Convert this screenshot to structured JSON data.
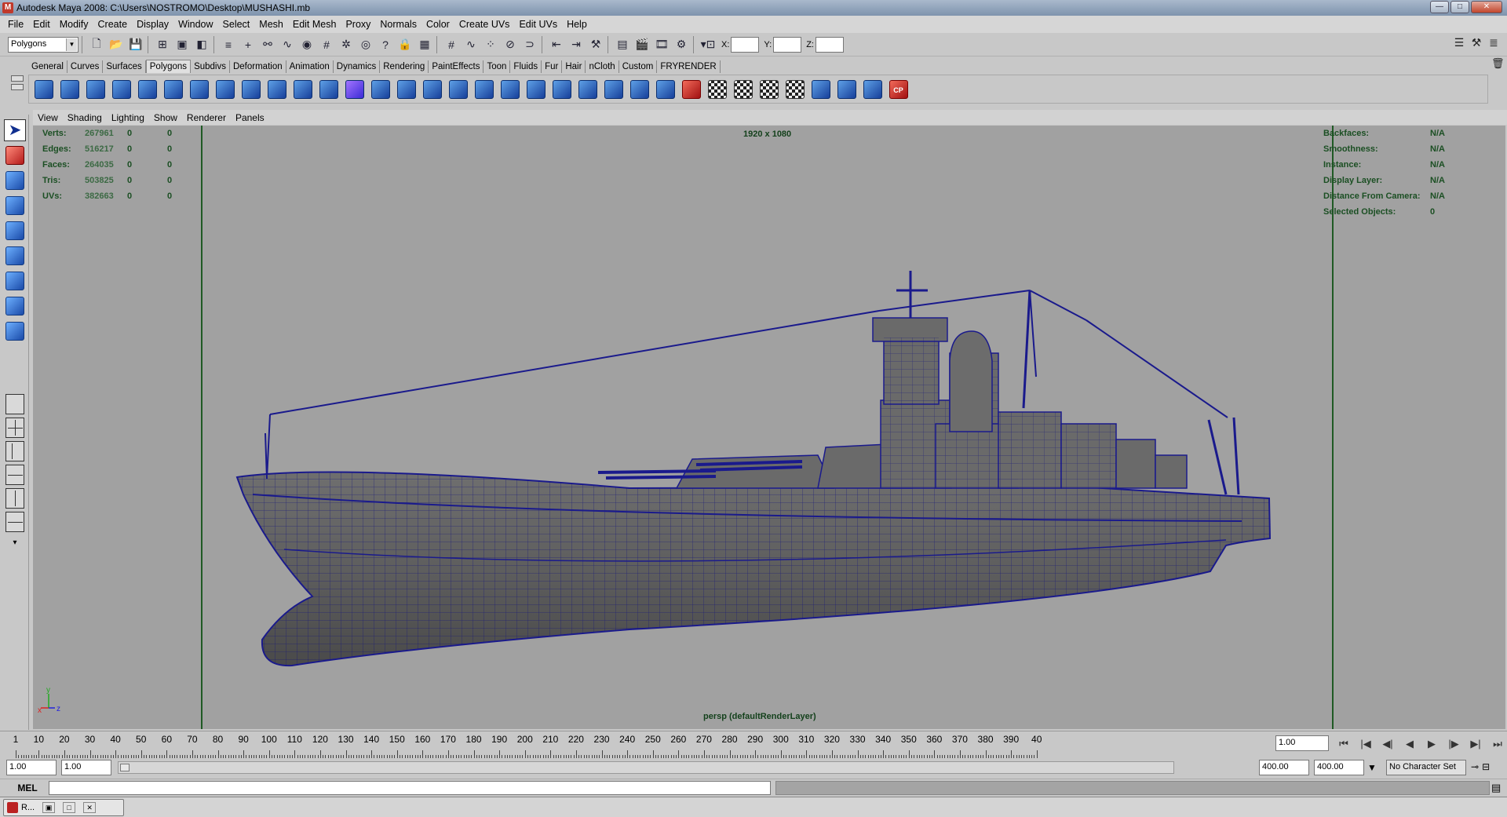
{
  "window": {
    "title": "Autodesk Maya 2008: C:\\Users\\NOSTROMO\\Desktop\\MUSHASHI.mb",
    "minimize": "—",
    "maximize": "□",
    "close": "✕"
  },
  "menubar": [
    "File",
    "Edit",
    "Modify",
    "Create",
    "Display",
    "Window",
    "Select",
    "Mesh",
    "Edit Mesh",
    "Proxy",
    "Normals",
    "Color",
    "Create UVs",
    "Edit UVs",
    "Help"
  ],
  "statusline": {
    "mode": "Polygons",
    "x_label": "X:",
    "y_label": "Y:",
    "z_label": "Z:",
    "x_value": "",
    "y_value": "",
    "z_value": ""
  },
  "shelf_tabs": [
    "General",
    "Curves",
    "Surfaces",
    "Polygons",
    "Subdivs",
    "Deformation",
    "Animation",
    "Dynamics",
    "Rendering",
    "PaintEffects",
    "Toon",
    "Fluids",
    "Fur",
    "Hair",
    "nCloth",
    "Custom",
    "FRYRENDER"
  ],
  "shelf_active": "Polygons",
  "shelf_last_icon_label": "CP",
  "panel_menu": [
    "View",
    "Shading",
    "Lighting",
    "Show",
    "Renderer",
    "Panels"
  ],
  "viewport": {
    "resolution": "1920 x 1080",
    "camera_label": "persp (defaultRenderLayer)",
    "stats": [
      {
        "label": "Verts:",
        "value": "267961",
        "sel": "0",
        "comp": "0"
      },
      {
        "label": "Edges:",
        "value": "516217",
        "sel": "0",
        "comp": "0"
      },
      {
        "label": "Faces:",
        "value": "264035",
        "sel": "0",
        "comp": "0"
      },
      {
        "label": "Tris:",
        "value": "503825",
        "sel": "0",
        "comp": "0"
      },
      {
        "label": "UVs:",
        "value": "382663",
        "sel": "0",
        "comp": "0"
      }
    ],
    "object_details": [
      {
        "label": "Backfaces:",
        "value": "N/A"
      },
      {
        "label": "Smoothness:",
        "value": "N/A"
      },
      {
        "label": "Instance:",
        "value": "N/A"
      },
      {
        "label": "Display Layer:",
        "value": "N/A"
      },
      {
        "label": "Distance From Camera:",
        "value": "N/A"
      },
      {
        "label": "Selected Objects:",
        "value": "0"
      }
    ],
    "axis": {
      "x": "x",
      "y": "y",
      "z": "z"
    }
  },
  "timeslider": {
    "ticks": [
      "1",
      "10",
      "20",
      "30",
      "40",
      "50",
      "60",
      "70",
      "80",
      "90",
      "100",
      "110",
      "120",
      "130",
      "140",
      "150",
      "160",
      "170",
      "180",
      "190",
      "200",
      "210",
      "220",
      "230",
      "240",
      "250",
      "260",
      "270",
      "280",
      "290",
      "300",
      "310",
      "320",
      "330",
      "340",
      "350",
      "360",
      "370",
      "380",
      "390",
      "40"
    ],
    "current_frame": "1.00"
  },
  "range": {
    "start": "1.00",
    "playback_start": "1.00",
    "playback_end": "400.00",
    "end": "400.00",
    "character_set": "No Character Set"
  },
  "commandline": {
    "label": "MEL",
    "input": ""
  },
  "taskbar": {
    "item": "R..."
  },
  "colors": {
    "viewport_bg": "#a1a1a1",
    "hud_text": "#1b4f23",
    "wireframe": "#1a1a8c",
    "ui_bg": "#c8c8c8"
  }
}
